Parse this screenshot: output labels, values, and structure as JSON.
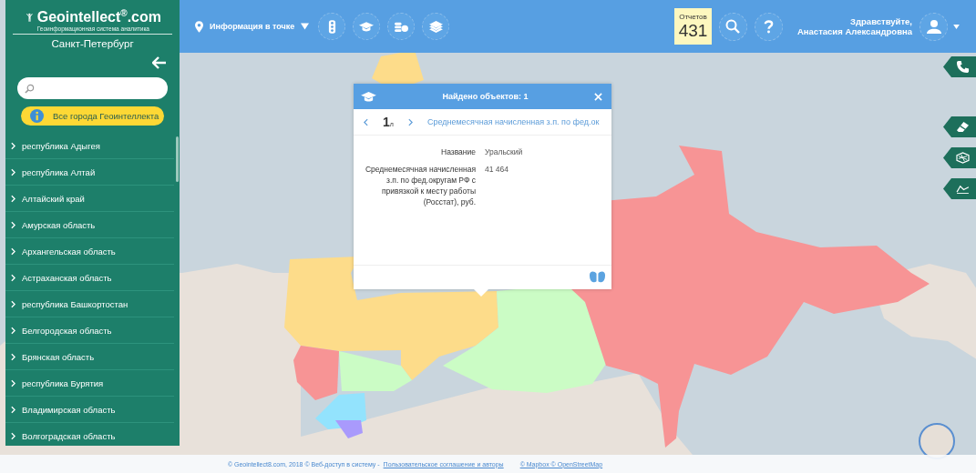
{
  "header": {
    "logo": "Geointellect$^{®}$.com",
    "tagline": "Геоинформационная система аналитика",
    "city": "Санкт-Петербург",
    "mode": "Информация в точке",
    "reports": {
      "label": "Отчетов",
      "count": "431"
    },
    "greeting": "Здравствуйте,",
    "user": "Анастасия Александровна"
  },
  "sidebar": {
    "all_cities_button": "Все города Геоинтеллекта",
    "regions": [
      "республика Адыгея",
      "республика Алтай",
      "Алтайский край",
      "Амурская область",
      "Архангельская область",
      "Астраханская область",
      "республика Башкортостан",
      "Белгородская область",
      "Брянская область",
      "республика Бурятия",
      "Владимирская область",
      "Волгоградская область"
    ]
  },
  "popup": {
    "title": "Найдено объектов: 1",
    "page": "1",
    "page_suffix": "л",
    "layer": "Среднемесячная начисленная з.п. по фед.ок",
    "fields": [
      {
        "label": "Название",
        "value": "Уральский"
      },
      {
        "label": "Среднемесячная начисленная з.п. по фед.округам РФ с привязкой к месту работы (Росстат), руб.",
        "value": "41 464"
      }
    ]
  },
  "footer": {
    "copyright": "© Geointellect8.com, 2018 © Веб-доступ в систему -",
    "agreement_link": "Пользовательское соглашение и авторы",
    "attribution_link": "© Mapbox © OpenStreetMap"
  }
}
